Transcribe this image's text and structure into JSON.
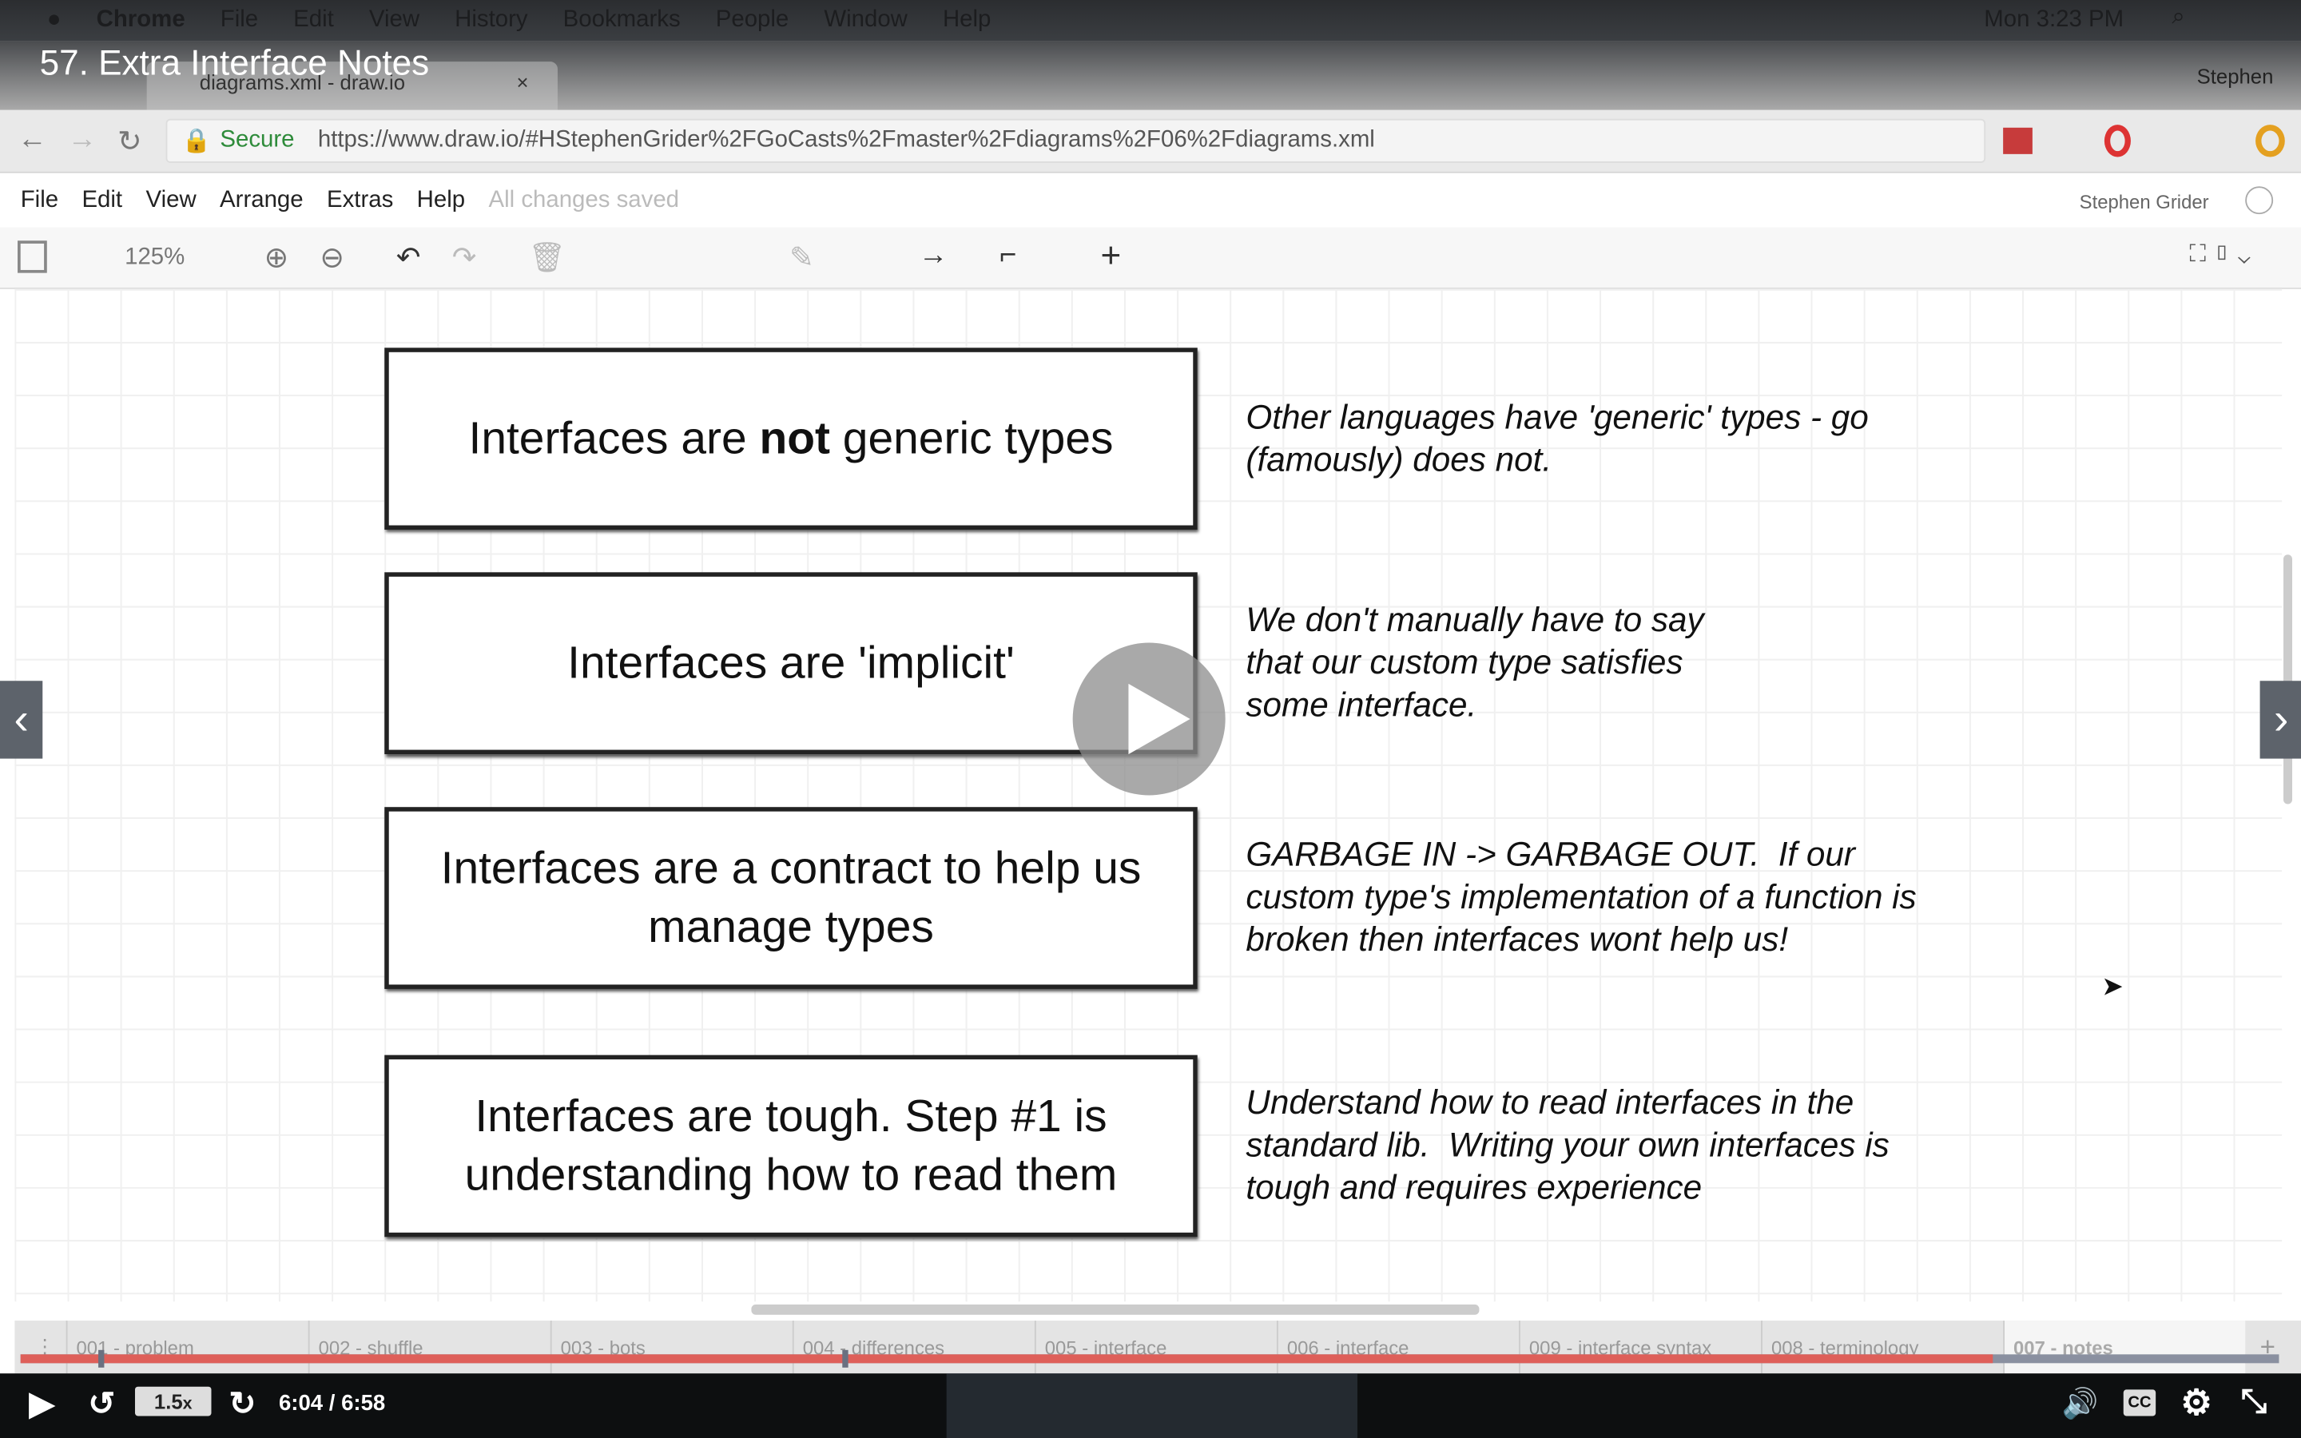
{
  "video": {
    "title": "57. Extra Interface Notes",
    "speed": "1.5",
    "speed_suffix": "x",
    "time": "6:04 / 6:58",
    "progress": 0.873
  },
  "macos": {
    "menu": [
      "Chrome",
      "File",
      "Edit",
      "View",
      "History",
      "Bookmarks",
      "People",
      "Window",
      "Help"
    ],
    "clock": "Mon 3:23 PM"
  },
  "browser": {
    "tab_title": "diagrams.xml - draw.io",
    "profile": "Stephen",
    "secure_label": "Secure",
    "url": "https://www.draw.io/#HStephenGrider%2FGoCasts%2Fmaster%2Fdiagrams%2F06%2Fdiagrams.xml"
  },
  "drawio": {
    "menu": [
      "File",
      "Edit",
      "View",
      "Arrange",
      "Extras",
      "Help"
    ],
    "status": "All changes saved",
    "user": "Stephen Grider",
    "zoom": "125%"
  },
  "diagram": [
    {
      "box_pre": "Interfaces are ",
      "box_bold": "not",
      "box_post": " generic types",
      "note": "Other languages have 'generic' types - go\n(famously) does not."
    },
    {
      "box": "Interfaces are 'implicit'",
      "note": "We don't manually have to say\nthat our custom type satisfies\nsome interface."
    },
    {
      "box": "Interfaces are a contract to help us manage types",
      "note": "GARBAGE IN -> GARBAGE OUT.  If our\ncustom type's implementation of a function is\nbroken then interfaces wont help us!"
    },
    {
      "box": "Interfaces are tough.  Step #1 is understanding how to read them",
      "note": "Understand how to read interfaces in the\nstandard lib.  Writing your own interfaces is\ntough and requires experience"
    }
  ],
  "pages": [
    "001 - problem",
    "002 - shuffle",
    "003 - bots",
    "004 - differences",
    "005 - interface",
    "006 - interface",
    "009 - interface syntax",
    "008 - terminology",
    "007 - notes"
  ],
  "colors": {
    "progress": "#de5f59",
    "secure": "#2e8b3a"
  }
}
